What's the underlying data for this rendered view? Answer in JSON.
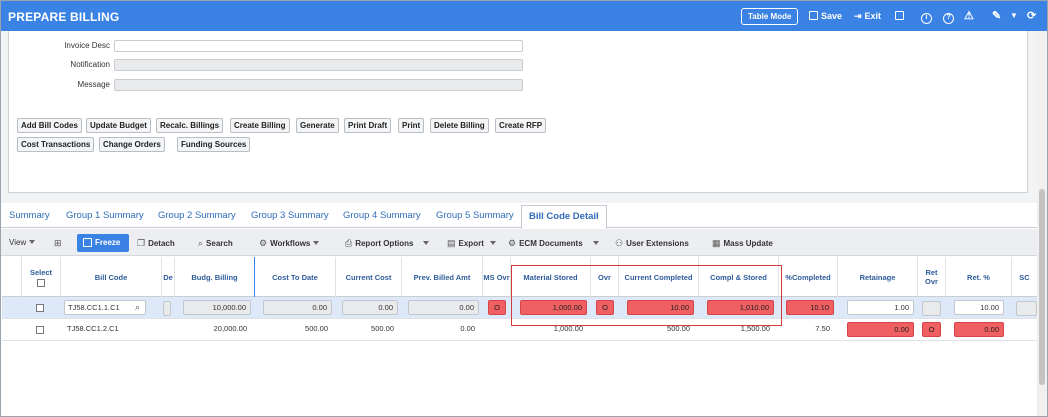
{
  "window": {
    "title": "PREPARE BILLING"
  },
  "titlebar": {
    "table_mode": "Table Mode",
    "save": "Save",
    "exit": "Exit",
    "icons": [
      "copy-icon",
      "info-icon",
      "help-icon",
      "warning-icon",
      "edit-icon",
      "refresh-icon"
    ]
  },
  "form": {
    "invoice_desc_label": "Invoice Desc",
    "notification_label": "Notification",
    "message_label": "Message"
  },
  "actions": {
    "row1": [
      "Add Bill Codes",
      "Update Budget",
      "Recalc. Billings",
      "Create Billing",
      "Generate",
      "Print Draft",
      "Print",
      "Delete Billing",
      "Create RFP"
    ],
    "row2": [
      "Cost Transactions",
      "Change Orders",
      "Funding Sources"
    ]
  },
  "tabs": [
    "Summary",
    "Group 1 Summary",
    "Group 2 Summary",
    "Group 3 Summary",
    "Group 4 Summary",
    "Group 5 Summary",
    "Bill Code Detail"
  ],
  "active_tab": "Bill Code Detail",
  "toolbar": {
    "view": "View",
    "freeze": "Freeze",
    "detach": "Detach",
    "search": "Search",
    "workflows": "Workflows",
    "report_options": "Report Options",
    "export": "Export",
    "ecm_documents": "ECM Documents",
    "user_extensions": "User Extensions",
    "mass_update": "Mass Update"
  },
  "grid": {
    "headers": {
      "select": "Select",
      "bill_code": "Bill Code",
      "de": "De",
      "budg_billing": "Budg. Billing",
      "cost_to_date": "Cost To Date",
      "current_cost": "Current Cost",
      "prev_billed_amt": "Prev. Billed Amt",
      "ms_ovr": "MS Ovr",
      "material_stored": "Material Stored",
      "ovr": "Ovr",
      "current_completed": "Current Completed",
      "compl_stored": "Compl & Stored",
      "pct_completed": "%Completed",
      "retainage": "Retainage",
      "ret_ovr": "Ret Ovr",
      "ret_pct": "Ret. %",
      "sc": "SC"
    },
    "rows": [
      {
        "bill_code": "TJ58.CC1.1.C1",
        "budg_billing": "10,000.00",
        "cost_to_date": "0.00",
        "current_cost": "0.00",
        "prev_billed_amt": "0.00",
        "ms_ovr": "O",
        "material_stored": "1,000.00",
        "ovr": "O",
        "current_completed": "10.00",
        "compl_stored": "1,010.00",
        "pct_completed": "10.10",
        "retainage": "1.00",
        "ret_ovr": "",
        "ret_pct": "10.00"
      },
      {
        "bill_code": "TJ58.CC1.2.C1",
        "budg_billing": "20,000.00",
        "cost_to_date": "500.00",
        "current_cost": "500.00",
        "prev_billed_amt": "0.00",
        "ms_ovr": "",
        "material_stored": "1,000.00",
        "ovr": "",
        "current_completed": "500.00",
        "compl_stored": "1,500.00",
        "pct_completed": "7.50",
        "retainage": "0.00",
        "ret_ovr": "O",
        "ret_pct": "0.00"
      }
    ]
  },
  "colors": {
    "titlebar": "#3a82e4",
    "highlight_red": "#f06063",
    "outline_red": "#d23b3b",
    "selected_row": "#dde9f9"
  }
}
